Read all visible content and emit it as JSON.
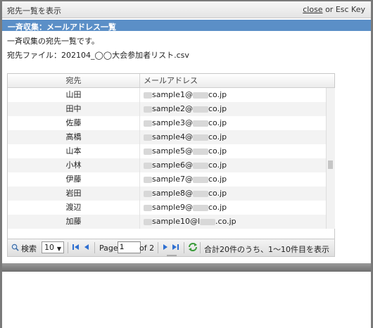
{
  "window": {
    "title": "宛先一覧を表示",
    "close_link": "close",
    "close_hint": "or Esc Key"
  },
  "section": {
    "header": "一斉収集：メールアドレス一覧",
    "description": "一斉収集の宛先一覧です。",
    "file_label": "宛先ファイル：202104_◯◯大会参加者リスト.csv"
  },
  "grid": {
    "columns": [
      "宛先",
      "メールアドレス"
    ],
    "rows": [
      {
        "name": "山田",
        "email_visible": "sample1@",
        "domain_tail": "co.jp"
      },
      {
        "name": "田中",
        "email_visible": "sample2@",
        "domain_tail": "co.jp"
      },
      {
        "name": "佐藤",
        "email_visible": "sample3@",
        "domain_tail": "co.jp"
      },
      {
        "name": "高橋",
        "email_visible": "sample4@",
        "domain_tail": "co.jp"
      },
      {
        "name": "山本",
        "email_visible": "sample5@",
        "domain_tail": "co.jp"
      },
      {
        "name": "小林",
        "email_visible": "sample6@",
        "domain_tail": "co.jp"
      },
      {
        "name": "伊藤",
        "email_visible": "sample7@",
        "domain_tail": "co.jp"
      },
      {
        "name": "岩田",
        "email_visible": "sample8@",
        "domain_tail": "co.jp"
      },
      {
        "name": "渡辺",
        "email_visible": "sample9@",
        "domain_tail": "co.jp"
      },
      {
        "name": "加藤",
        "email_visible": "sample10@l",
        "domain_tail": ".co.jp"
      }
    ]
  },
  "pager": {
    "search_label": "検索",
    "page_size": "10",
    "page_label": "Page",
    "page_value": "1",
    "of_label": "of 2",
    "status": "合計20件のうち、1〜10件目を表示"
  },
  "icons": {
    "search": "search-icon",
    "first": "first-page-icon",
    "prev": "prev-page-icon",
    "next": "next-page-icon",
    "last": "last-page-icon",
    "refresh": "refresh-icon"
  },
  "colors": {
    "header_blue": "#5b8fc7",
    "nav_blue": "#2e6fd1",
    "refresh_green": "#3a9b3a"
  }
}
